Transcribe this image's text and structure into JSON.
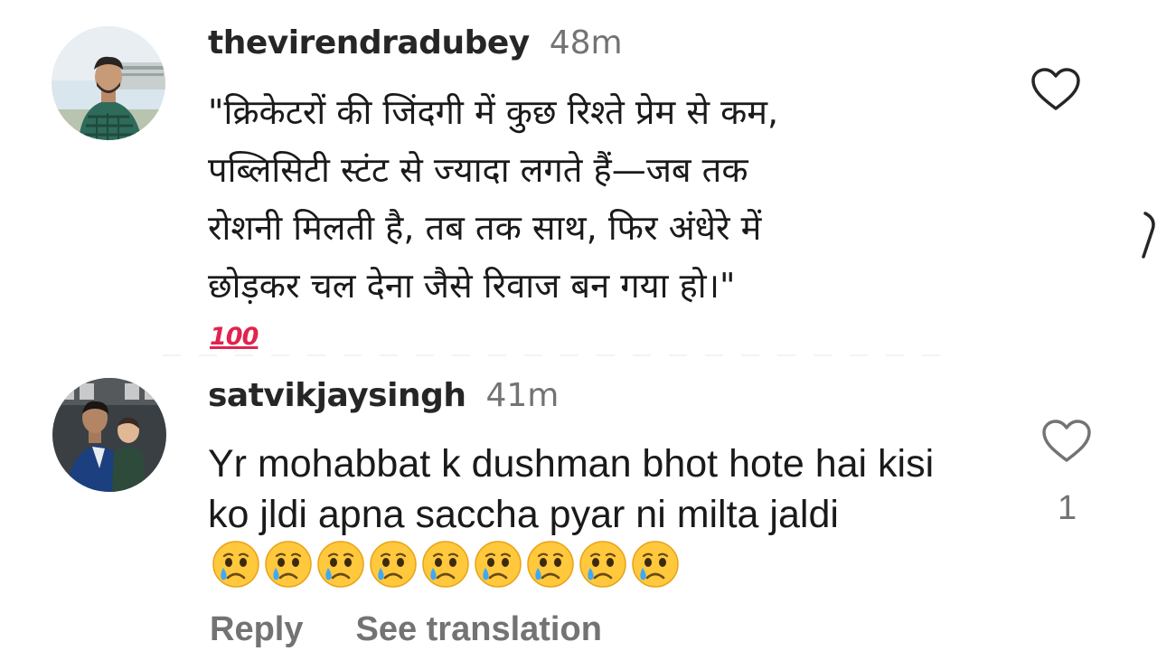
{
  "comments": [
    {
      "username": "thevirendradubey",
      "time": "48m",
      "text": "\"क्रिकेटरों की जिंदगी में कुछ रिश्ते प्रेम से कम,\nपब्लिसिटी स्टंट से ज्यादा लगते हैं—जब तक\nरोशनी मिलती है, तब तक साथ, फिर अंधेरे में\nछोड़कर चल देना जैसे रिवाज बन गया हो।\"",
      "reaction": "100",
      "like_icon": "heart-outline-icon"
    },
    {
      "username": "satvikjaysingh",
      "time": "41m",
      "text": "Yr mohabbat k dushman bhot hote hai kisi ko jldi apna saccha pyar ni milta jaldi",
      "emoji_icon": "crying-face-emoji",
      "emoji_count": 9,
      "like_icon": "heart-outline-icon",
      "like_count": "1",
      "actions": {
        "reply": "Reply",
        "see_translation": "See translation"
      }
    }
  ],
  "colors": {
    "text": "#1a1a1a",
    "username": "#262626",
    "muted": "#737373",
    "hundred_emoji": "#e0244d"
  }
}
